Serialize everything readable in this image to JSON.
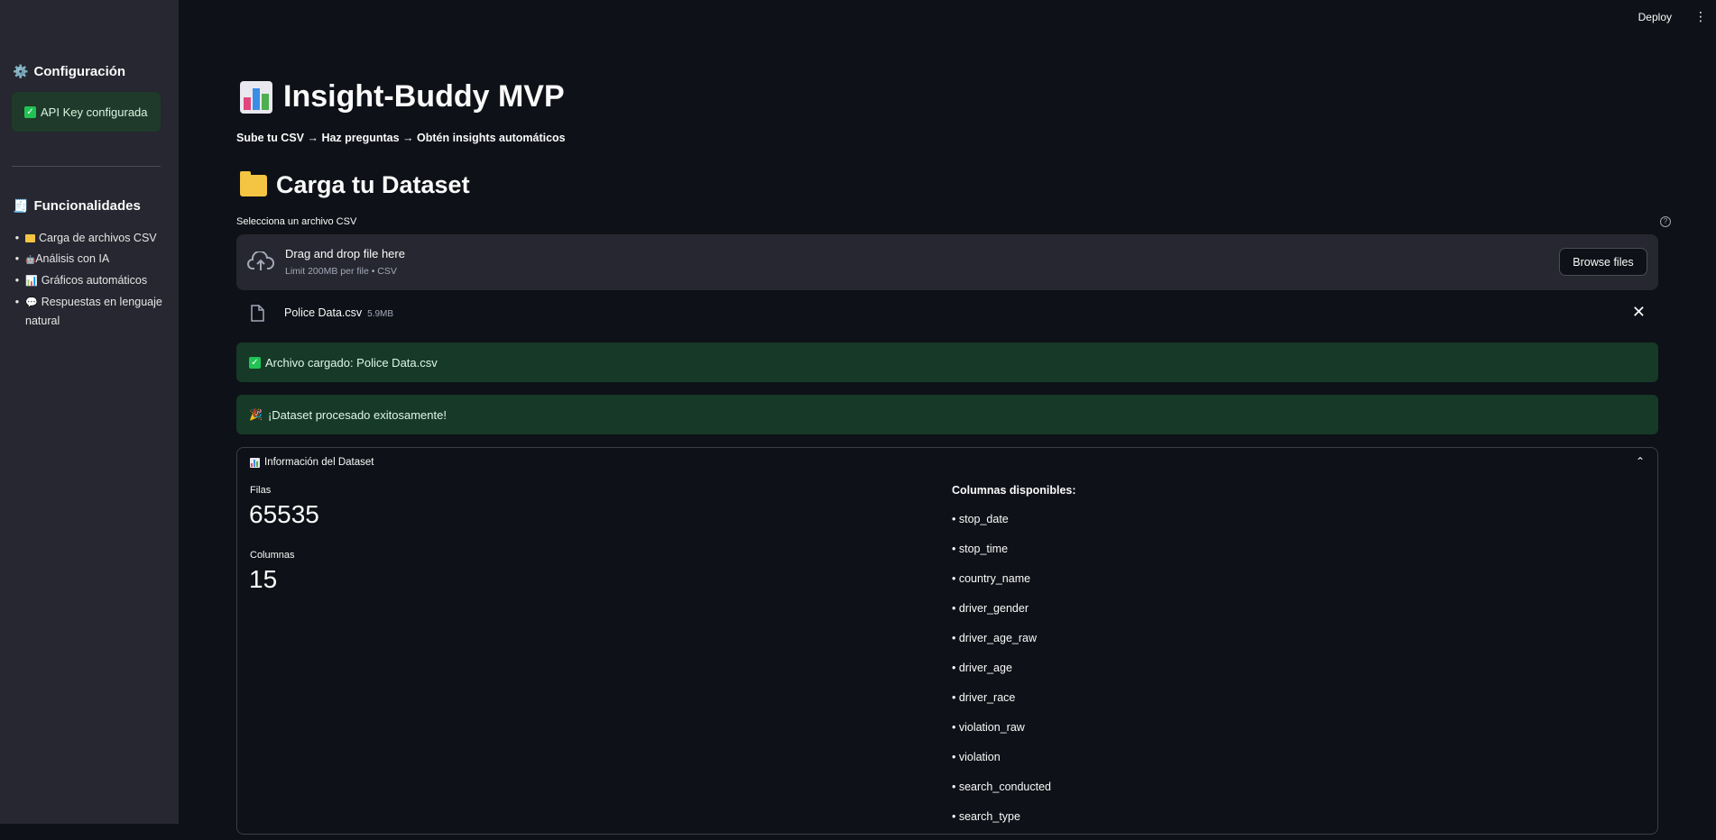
{
  "sidebar": {
    "config_heading": "Configuración",
    "api_status": "API Key configurada",
    "features_heading": "Funcionalidades",
    "features": [
      {
        "icon": "📁",
        "label": "Carga de archivos CSV"
      },
      {
        "icon": "🤖",
        "label": "Análisis con IA"
      },
      {
        "icon": "📊",
        "label": "Gráficos automáticos"
      },
      {
        "icon": "💬",
        "label": "Respuestas en lenguaje natural"
      }
    ]
  },
  "header": {
    "deploy_label": "Deploy",
    "menu_icon": "⋮"
  },
  "main": {
    "title": "Insight-Buddy MVP",
    "subtitle": "Sube tu CSV → Haz preguntas → Obtén insights automáticos",
    "upload_heading": "Carga tu Dataset",
    "uploader": {
      "label": "Selecciona un archivo CSV",
      "drop_title": "Drag and drop file here",
      "drop_sub": "Limit 200MB per file • CSV",
      "browse_label": "Browse files",
      "help_icon": "?"
    },
    "file": {
      "name": "Police Data.csv",
      "size": "5.9MB",
      "close_icon": "✕"
    },
    "alerts": {
      "loaded": "Archivo cargado: Police Data.csv",
      "processed": "¡Dataset procesado exitosamente!"
    },
    "dataset_info": {
      "header": "Información del Dataset",
      "chevron_icon": "⌃",
      "rows_label": "Filas",
      "rows_value": "65535",
      "cols_label": "Columnas",
      "cols_value": "15",
      "columns_title": "Columnas disponibles:",
      "columns": [
        "• stop_date",
        "• stop_time",
        "• country_name",
        "• driver_gender",
        "• driver_age_raw",
        "• driver_age",
        "• driver_race",
        "• violation_raw",
        "• violation",
        "• search_conducted",
        "• search_type"
      ]
    }
  },
  "colors": {
    "app_bg": "#0e1117",
    "sidebar_bg": "#262730",
    "success_bg": "#173928",
    "text": "#fafafa"
  }
}
